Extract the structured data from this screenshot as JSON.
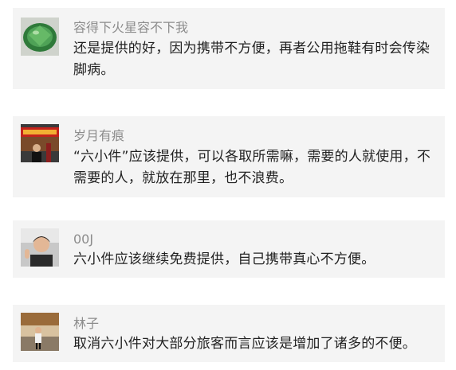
{
  "comments": [
    {
      "avatar_icon": "green-ice-pop-avatar",
      "name": "容得下火星容不下我",
      "text": "还是提供的好，因为携带不方便，再者公用拖鞋有时会传染脚病。"
    },
    {
      "avatar_icon": "storefront-photo-avatar",
      "name": "岁月有痕",
      "text": "“六小件”应该提供，可以各取所需嘛，需要的人就使用，不需要的人，就放在那里，也不浪费。"
    },
    {
      "avatar_icon": "person-portrait-avatar",
      "name": "00J",
      "text": "六小件应该继续免费提供，自己携带真心不方便。"
    },
    {
      "avatar_icon": "street-photo-avatar",
      "name": "林子",
      "text": "取消六小件对大部分旅客而言应该是增加了诸多的不便。"
    }
  ]
}
